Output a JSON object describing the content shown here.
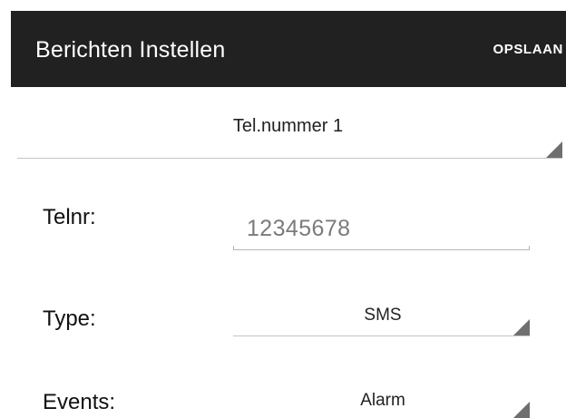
{
  "action_bar": {
    "title": "Berichten Instellen",
    "save_label": "OPSLAAN",
    "background": "#212121"
  },
  "profile_selector": {
    "selected": "Tel.nummer 1"
  },
  "fields": {
    "telnr": {
      "label": "Telnr:",
      "value": "12345678"
    },
    "type": {
      "label": "Type:",
      "selected": "SMS"
    },
    "events": {
      "label": "Events:",
      "selected": "Alarm"
    }
  },
  "icons": {
    "spinner_arrow": "dropdown-triangle-icon"
  }
}
